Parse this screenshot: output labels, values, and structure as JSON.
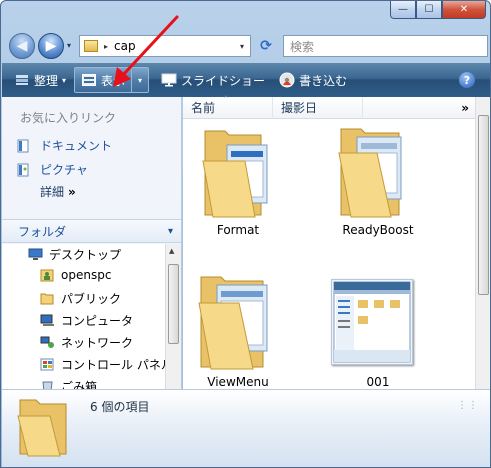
{
  "window": {
    "caption_buttons": {
      "minimize": "—",
      "maximize": "☐",
      "close": "✕"
    }
  },
  "address_bar": {
    "back_glyph": "◀",
    "forward_glyph": "▶",
    "separator": "▸",
    "path": "cap",
    "dropdown_glyph": "▾",
    "refresh_glyph": "⟳",
    "search_placeholder": "検索"
  },
  "toolbar": {
    "organize_label": "整理",
    "views_label": "表示",
    "slideshow_label": "スライドショー",
    "burn_label": "書き込む",
    "help_glyph": "?",
    "dropdown_glyph": "▾",
    "icons": [
      "organize-icon",
      "views-icon",
      "slideshow-icon",
      "burn-icon",
      "help-icon"
    ]
  },
  "navigation_pane": {
    "favorites_title": "お気に入りリンク",
    "favorites": [
      {
        "label": "ドキュメント",
        "icon": "documents-icon"
      },
      {
        "label": "ピクチャ",
        "icon": "pictures-icon"
      }
    ],
    "more_label": "詳細",
    "more_glyph": "»",
    "folders_title": "フォルダ",
    "folders_chevron": "▾",
    "tree": [
      {
        "label": "デスクトップ",
        "icon": "desktop-icon"
      },
      {
        "label": "openspc",
        "icon": "user-folder-icon"
      },
      {
        "label": "パブリック",
        "icon": "public-folder-icon"
      },
      {
        "label": "コンピュータ",
        "icon": "computer-icon"
      },
      {
        "label": "ネットワーク",
        "icon": "network-icon"
      },
      {
        "label": "コントロール パネル",
        "icon": "control-panel-icon"
      },
      {
        "label": "ごみ箱",
        "icon": "recycle-bin-icon"
      }
    ]
  },
  "content": {
    "columns": [
      "名前",
      "撮影日"
    ],
    "more_columns_glyph": "»",
    "sort_glyph": "^",
    "items": [
      {
        "label": "Format",
        "type": "folder"
      },
      {
        "label": "ReadyBoost",
        "type": "folder"
      },
      {
        "label": "ViewMenu",
        "type": "folder"
      },
      {
        "label": "001",
        "type": "image"
      }
    ]
  },
  "details_pane": {
    "item_count": "6 個の項目"
  },
  "colors": {
    "annotation_arrow": "#e8101a",
    "command_bar": "#2f5d88",
    "link_text": "#1e4f9b"
  }
}
